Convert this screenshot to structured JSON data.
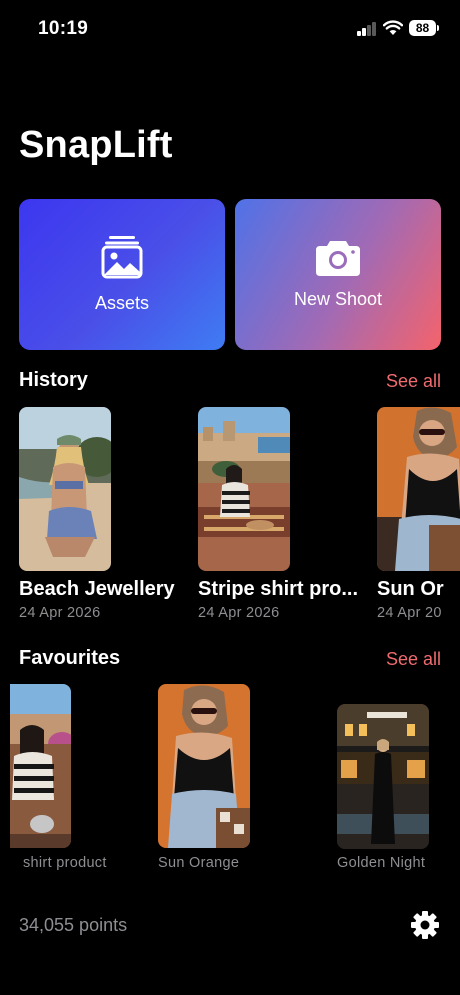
{
  "status": {
    "time": "10:19",
    "battery": "88"
  },
  "app": {
    "title": "SnapLift"
  },
  "actions": [
    {
      "label": "Assets",
      "icon": "photo-stack-icon"
    },
    {
      "label": "New Shoot",
      "icon": "camera-icon"
    }
  ],
  "history": {
    "title": "History",
    "see_all": "See all",
    "items": [
      {
        "title": "Beach Jewellery",
        "date": "24 Apr 2026"
      },
      {
        "title": "Stripe shirt pro...",
        "date": "24 Apr 2026"
      },
      {
        "title": "Sun Or",
        "date": "24 Apr 20"
      }
    ]
  },
  "favourites": {
    "title": "Favourites",
    "see_all": "See all",
    "items": [
      {
        "caption": "shirt product"
      },
      {
        "caption": "Sun Orange"
      },
      {
        "caption": "Golden Night"
      }
    ]
  },
  "footer": {
    "points": "34,055 points",
    "settings_icon": "gear-icon"
  },
  "colors": {
    "accent": "#ef6b6f",
    "background": "#000000",
    "secondary_text": "#8e8e93"
  }
}
